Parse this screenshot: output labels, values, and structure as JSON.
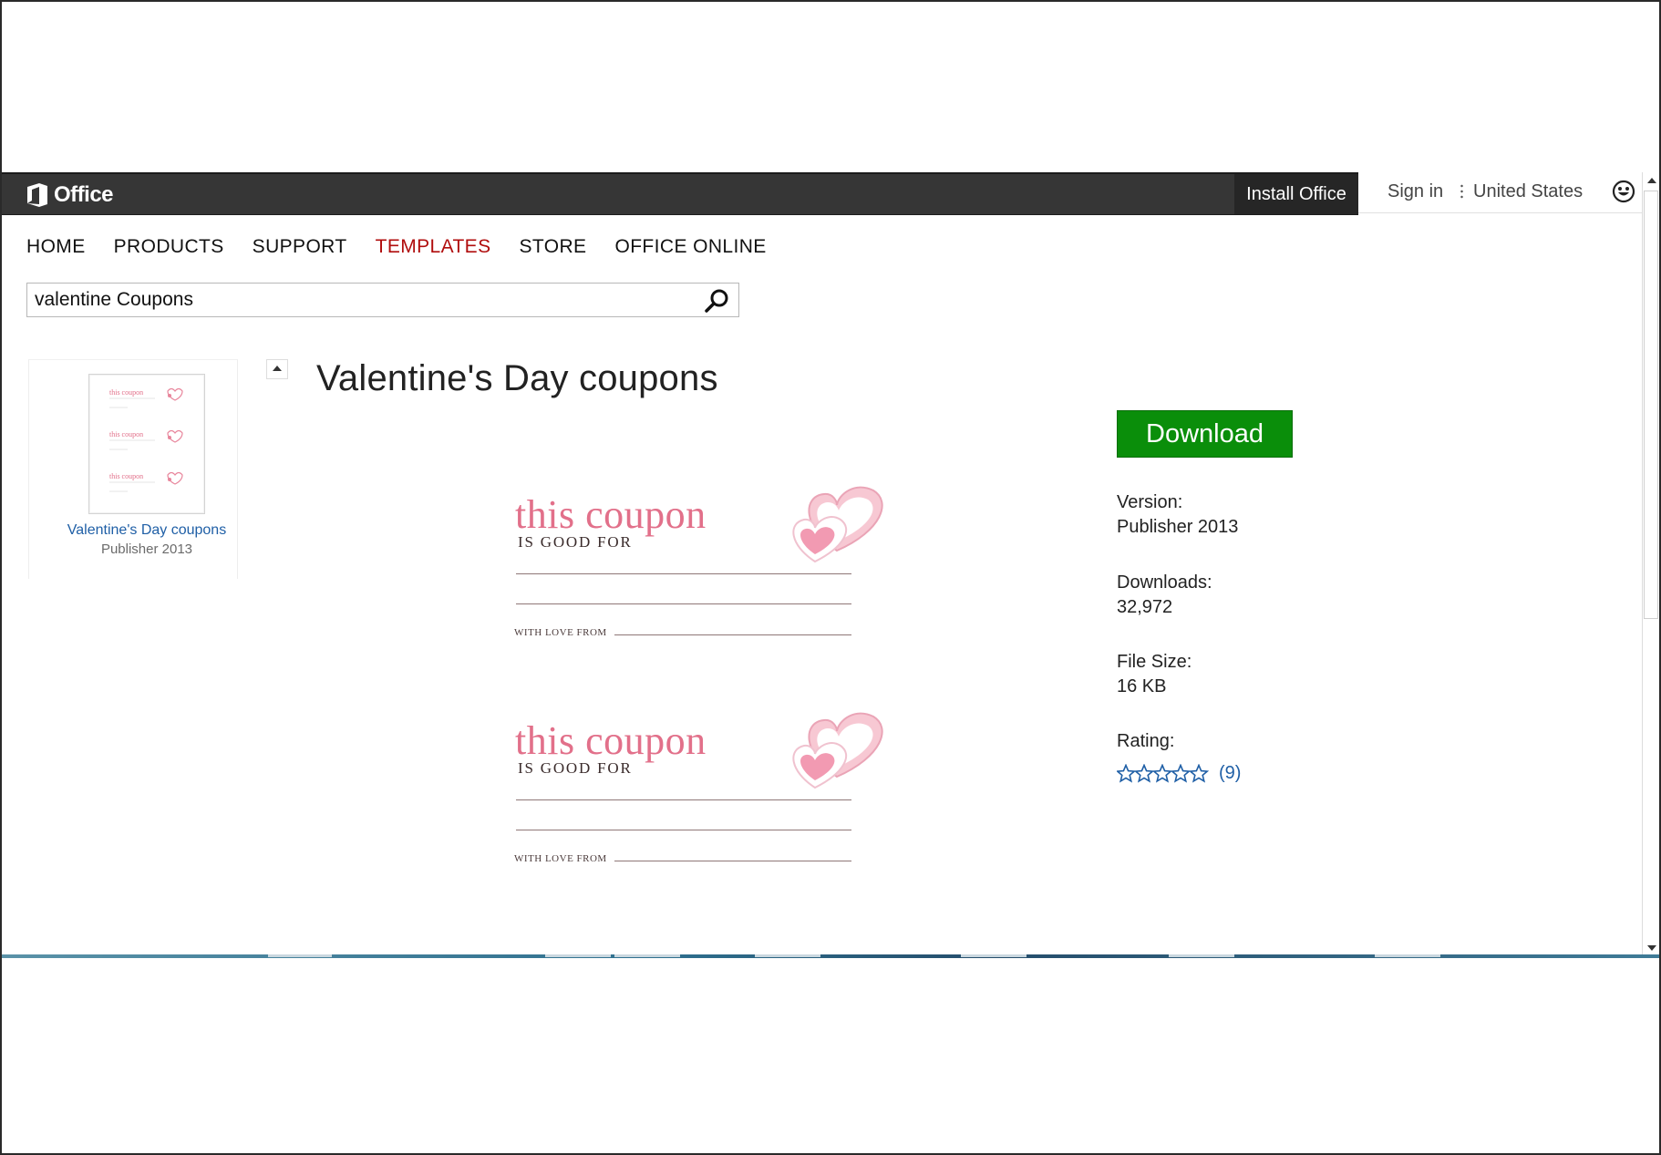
{
  "header": {
    "logo_text": "Office",
    "install_label": "Install Office",
    "sign_in_label": "Sign in",
    "country_label": "United States",
    "feedback_icon": "smiley-icon"
  },
  "nav": {
    "items": [
      {
        "label": "HOME"
      },
      {
        "label": "PRODUCTS"
      },
      {
        "label": "SUPPORT"
      },
      {
        "label": "TEMPLATES",
        "active": true
      },
      {
        "label": "STORE"
      },
      {
        "label": "OFFICE ONLINE"
      }
    ]
  },
  "search": {
    "value": "valentine Coupons",
    "icon": "search-icon"
  },
  "sidebar": {
    "results": [
      {
        "title": "Valentine's Day coupons",
        "app": "Publisher 2013"
      }
    ]
  },
  "template": {
    "title": "Valentine's Day coupons",
    "download_label": "Download",
    "version_label": "Version:",
    "version_value": "Publisher 2013",
    "downloads_label": "Downloads:",
    "downloads_value": "32,972",
    "file_size_label": "File Size:",
    "file_size_value": "16 KB",
    "rating_label": "Rating:",
    "rating_stars": 0,
    "rating_count": "(9)"
  },
  "preview": {
    "coupon_title": "this coupon",
    "coupon_subtitle": "IS GOOD FOR",
    "with_love_label": "WITH LOVE FROM"
  },
  "colors": {
    "topbar": "#363636",
    "active_nav": "#b00d0d",
    "download_button": "#0a8e0a",
    "link": "#1f5fa6",
    "coupon_pink": "#e2708a"
  }
}
